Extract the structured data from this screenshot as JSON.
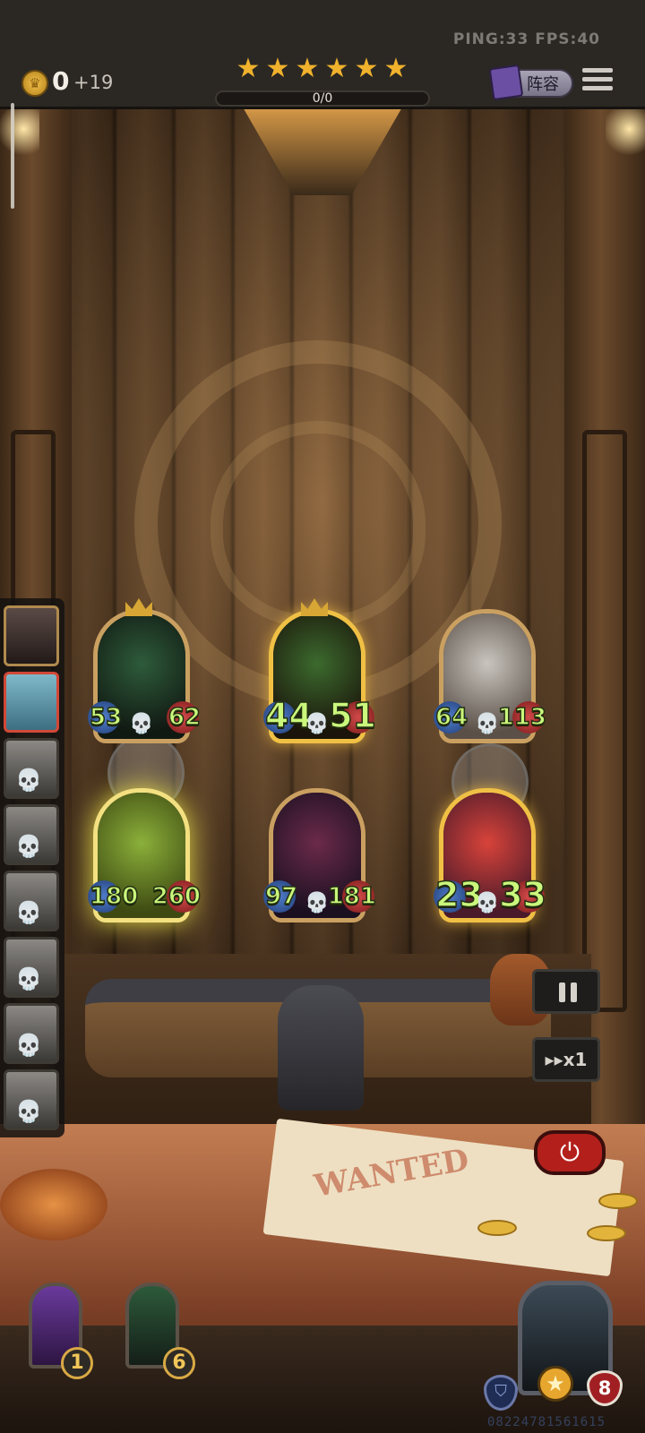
{
  "hud": {
    "network": "PING:33   FPS:40",
    "gold": "0",
    "gold_income": "+19",
    "stars": [
      "★",
      "★",
      "★",
      "★",
      "★",
      "★"
    ],
    "progress_text": "0/0",
    "progress_fraction": 0,
    "roster_label": "阵容"
  },
  "sidebar": {
    "items": [
      {
        "name": "bat-hero",
        "state": "player"
      },
      {
        "name": "robot-hero",
        "state": "active"
      },
      {
        "name": "white-haired-hero",
        "state": "eliminated"
      },
      {
        "name": "goggles-hero",
        "state": "eliminated"
      },
      {
        "name": "hat-hero",
        "state": "eliminated"
      },
      {
        "name": "blonde-hero",
        "state": "eliminated"
      },
      {
        "name": "dark-hero",
        "state": "eliminated"
      },
      {
        "name": "old-man-hero",
        "state": "eliminated"
      }
    ],
    "skull_glyph": "💀"
  },
  "board": {
    "top_row": [
      {
        "atk": "53",
        "hp": "62",
        "style": "normal",
        "subject": "tentacle creature"
      },
      {
        "atk": "44",
        "hp": "51",
        "style": "gold",
        "subject": "tentacle creature golden"
      },
      {
        "atk": "64",
        "hp": "113",
        "style": "normal",
        "subject": "top-hat gentleman"
      }
    ],
    "bottom_row": [
      {
        "atk": "180",
        "hp": "260",
        "style": "glow",
        "subject": "grinning goblin"
      },
      {
        "atk": "97",
        "hp": "181",
        "style": "normal",
        "subject": "dark-haired witch"
      },
      {
        "atk": "23",
        "hp": "33",
        "style": "gold",
        "subject": "clown"
      }
    ]
  },
  "controls": {
    "pause_icon": "pause-icon",
    "speed_label": "▸▸x1",
    "power_glyph": "⏻"
  },
  "table": {
    "poster_word": "WANTED"
  },
  "hand": {
    "left_count": "1",
    "right_count": "6"
  },
  "hero": {
    "star_glyph": "★",
    "shield_glyph": "⛉",
    "hp": "8",
    "player_id": "08224781561615"
  },
  "colors": {
    "stat_text": "#caf77c",
    "gold_accent": "#f0b22c",
    "danger": "#b3201c"
  }
}
